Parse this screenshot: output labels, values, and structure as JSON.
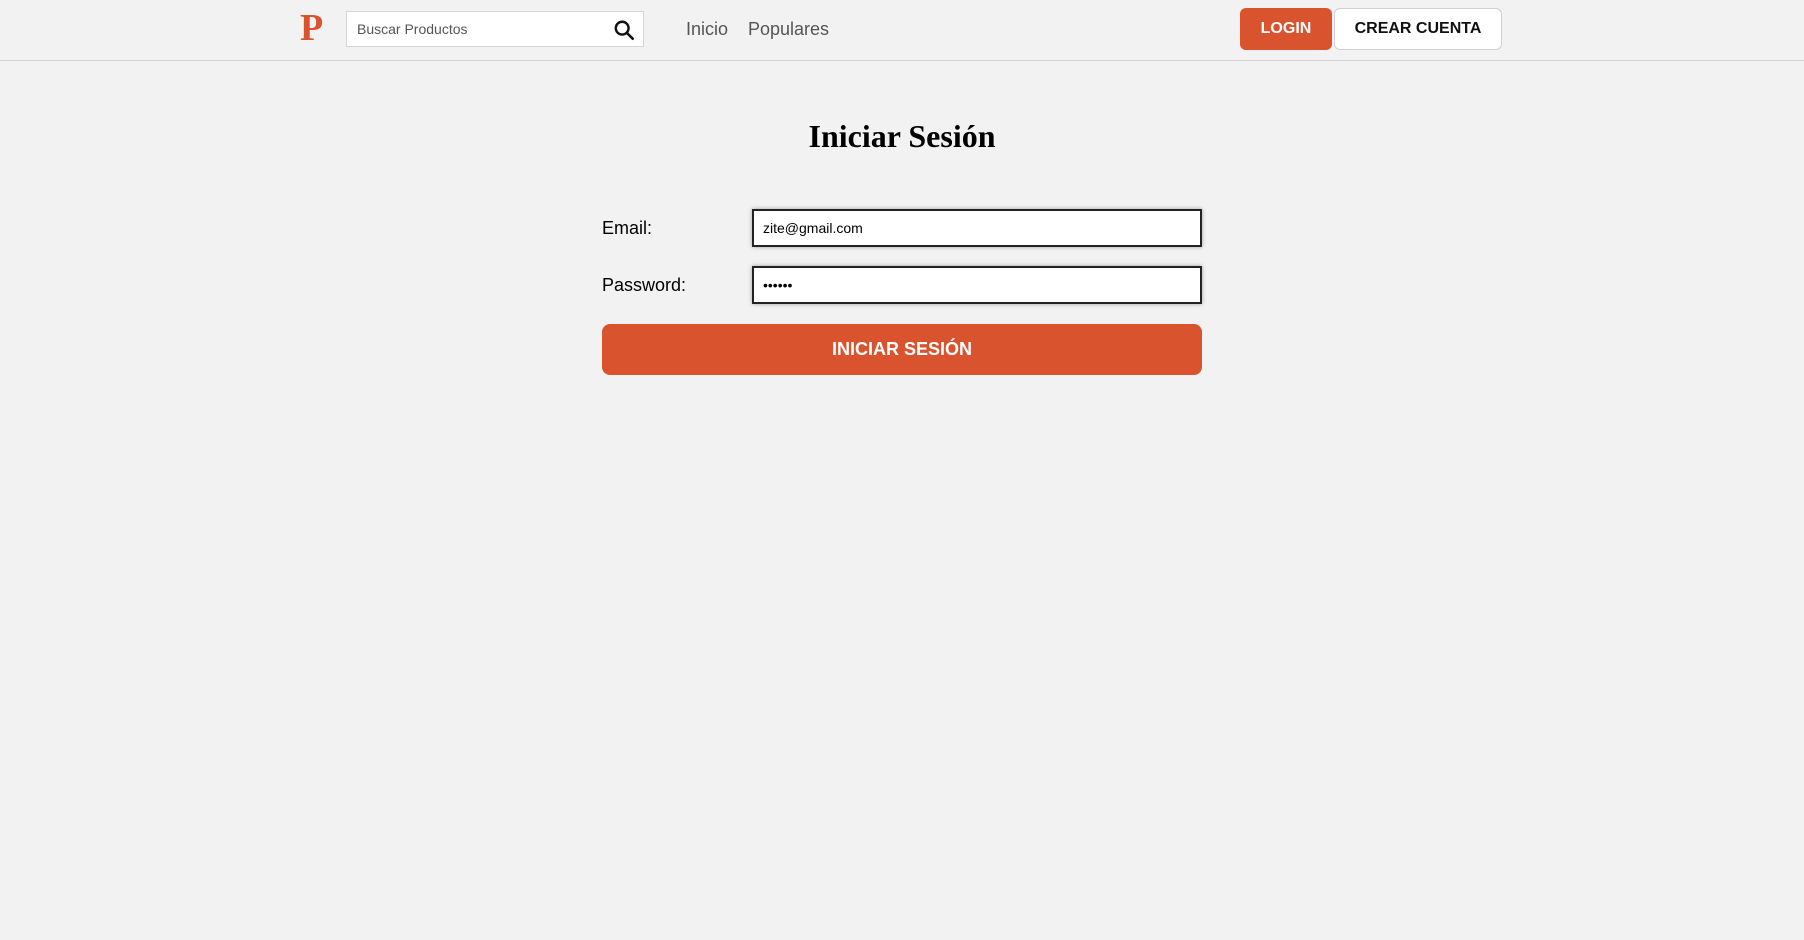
{
  "header": {
    "logo": "P",
    "search": {
      "placeholder": "Buscar Productos",
      "icon": "search-icon"
    },
    "nav": {
      "inicio": "Inicio",
      "populares": "Populares"
    },
    "login_label": "LOGIN",
    "crear_cuenta_label": "CREAR CUENTA"
  },
  "main": {
    "title": "Iniciar Sesión",
    "email_label": "Email:",
    "email_value": "zite@gmail.com",
    "password_label": "Password:",
    "password_value": "••••••",
    "submit_label": "INICIAR SESIÓN"
  },
  "colors": {
    "accent": "#d9532f",
    "background": "#f2f2f2"
  }
}
